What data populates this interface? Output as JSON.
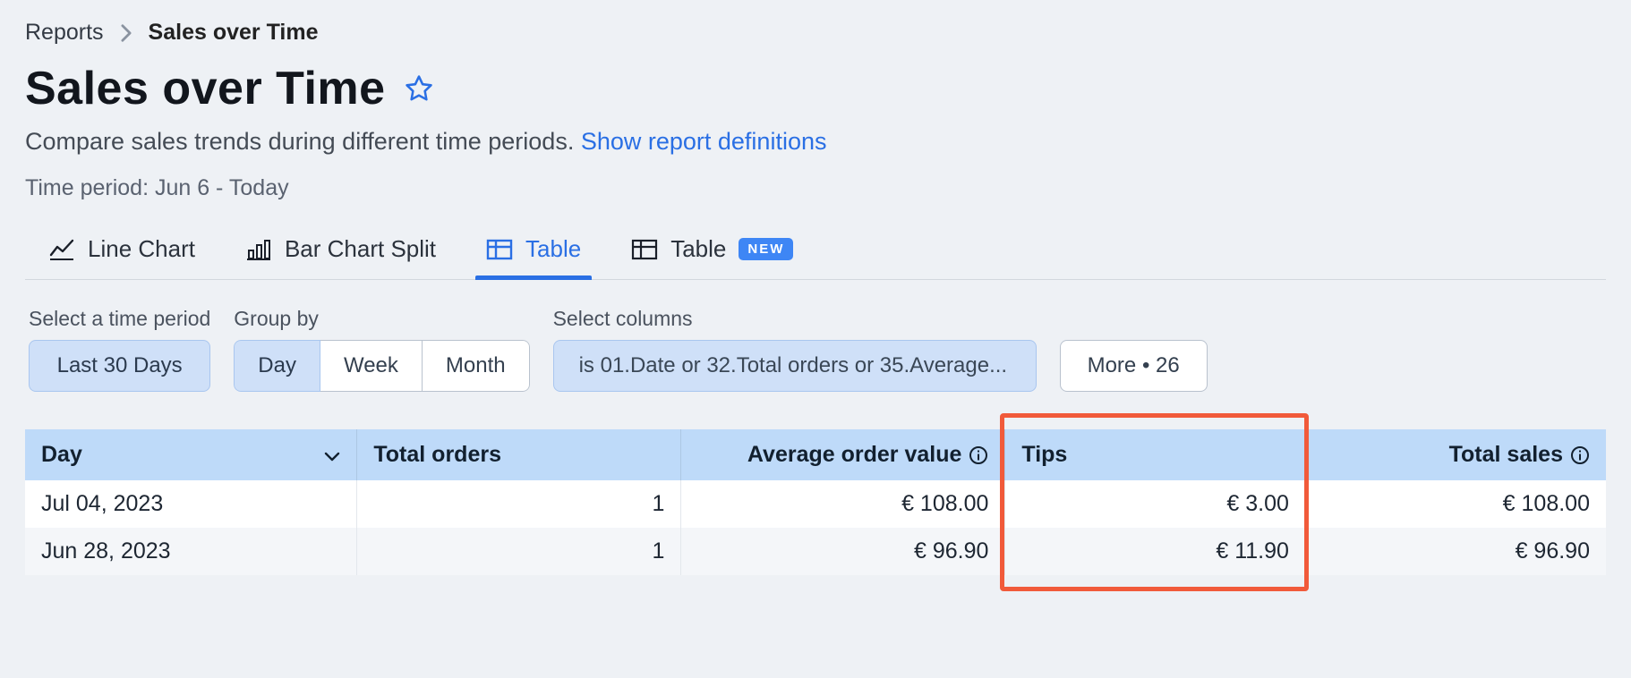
{
  "breadcrumb": {
    "root": "Reports",
    "current": "Sales over Time"
  },
  "title": "Sales over Time",
  "subtitle": {
    "text": "Compare sales trends during different time periods. ",
    "link": "Show report definitions"
  },
  "time_period_label": "Time period: Jun 6 - Today",
  "tabs": {
    "line_chart": "Line Chart",
    "bar_chart_split": "Bar Chart Split",
    "table": "Table",
    "table_new": "Table",
    "new_badge": "NEW"
  },
  "filters": {
    "time_period": {
      "label": "Select a time period",
      "value": "Last 30 Days"
    },
    "group_by": {
      "label": "Group by",
      "options": [
        "Day",
        "Week",
        "Month"
      ],
      "selected": "Day"
    },
    "columns": {
      "label": "Select columns",
      "value": "is 01.Date or 32.Total orders or 35.Average..."
    },
    "more": "More • 26"
  },
  "table": {
    "headers": {
      "day": "Day",
      "total_orders": "Total orders",
      "avg_order_value": "Average order value",
      "tips": "Tips",
      "total_sales": "Total sales"
    },
    "rows": [
      {
        "day": "Jul 04, 2023",
        "total_orders": "1",
        "avg": "€ 108.00",
        "tips": "€ 3.00",
        "total": "€ 108.00"
      },
      {
        "day": "Jun 28, 2023",
        "total_orders": "1",
        "avg": "€ 96.90",
        "tips": "€ 11.90",
        "total": "€ 96.90"
      }
    ]
  }
}
